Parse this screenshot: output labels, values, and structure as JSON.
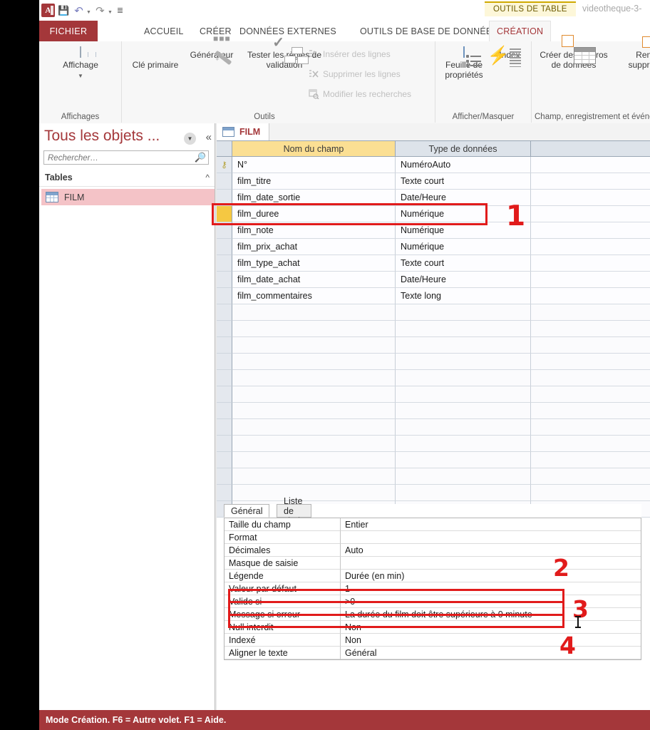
{
  "titlebar": {
    "app_icon": "access-logo-icon",
    "quick_access": [
      {
        "name": "save-icon",
        "glyph": "ὋE"
      },
      {
        "name": "undo-icon",
        "glyph": "↶"
      },
      {
        "name": "redo-icon",
        "glyph": "↷"
      },
      {
        "name": "customize-quick-access-icon",
        "glyph": "≡"
      }
    ],
    "contextual_tools_label": "OUTILS DE TABLE",
    "document_title": "videotheque-3-"
  },
  "ribbon": {
    "tabs": [
      {
        "label": "FICHIER",
        "active": false,
        "file": true
      },
      {
        "label": "ACCUEIL",
        "active": false
      },
      {
        "label": "CRÉER",
        "active": false
      },
      {
        "label": "DONNÉES EXTERNES",
        "active": false
      },
      {
        "label": "OUTILS DE BASE DE DONNÉES",
        "active": false
      },
      {
        "label": "CRÉATION",
        "active": true
      }
    ],
    "groups": [
      {
        "name": "affichages",
        "label": "Affichages",
        "buttons": [
          {
            "label": "Affichage",
            "caret": "▾"
          }
        ]
      },
      {
        "name": "outils",
        "label": "Outils",
        "buttons": [
          {
            "label": "Clé primaire"
          },
          {
            "label": "Générateur"
          },
          {
            "label": "Tester les règles de validation"
          }
        ],
        "small_commands": [
          {
            "label": "Insérer des lignes"
          },
          {
            "label": "Supprimer les lignes"
          },
          {
            "label": "Modifier les recherches"
          }
        ]
      },
      {
        "name": "afficher-masquer",
        "label": "Afficher/Masquer",
        "buttons": [
          {
            "label": "Feuille de propriétés"
          },
          {
            "label": "Index"
          }
        ]
      },
      {
        "name": "champ-enregistrement-evenements",
        "label": "Champ, enregistrement et événeme",
        "buttons": [
          {
            "label": "Créer des macros de données",
            "caret": "▾"
          },
          {
            "label": "Renomm supprimer un"
          }
        ]
      }
    ]
  },
  "navpane": {
    "title": "Tous les objets ...",
    "dropdown_icon": "chevron-down-icon",
    "collapse_icon": "double-chevron-left-icon",
    "search_placeholder": "Rechercher…",
    "search_value": "",
    "search_icon": "search-icon",
    "groups": [
      {
        "label": "Tables",
        "collapse_glyph": "«",
        "items": [
          {
            "label": "FILM",
            "icon": "table-icon",
            "selected": true
          }
        ]
      }
    ]
  },
  "document": {
    "tab_label": "FILM",
    "tab_icon": "table-icon",
    "grid": {
      "headers": [
        "Nom du champ",
        "Type de données",
        ""
      ],
      "rows": [
        {
          "field": "N°",
          "type": "NuméroAuto",
          "primary_key": true,
          "selected": false
        },
        {
          "field": "film_titre",
          "type": "Texte court",
          "primary_key": false,
          "selected": false
        },
        {
          "field": "film_date_sortie",
          "type": "Date/Heure",
          "primary_key": false,
          "selected": false
        },
        {
          "field": "film_duree",
          "type": "Numérique",
          "primary_key": false,
          "selected": true
        },
        {
          "field": "film_note",
          "type": "Numérique",
          "primary_key": false,
          "selected": false
        },
        {
          "field": "film_prix_achat",
          "type": "Numérique",
          "primary_key": false,
          "selected": false
        },
        {
          "field": "film_type_achat",
          "type": "Texte court",
          "primary_key": false,
          "selected": false
        },
        {
          "field": "film_date_achat",
          "type": "Date/Heure",
          "primary_key": false,
          "selected": false
        },
        {
          "field": "film_commentaires",
          "type": "Texte long",
          "primary_key": false,
          "selected": false
        }
      ],
      "empty_row_count": 13
    }
  },
  "properties": {
    "tabs": [
      {
        "label": "Général",
        "active": true
      },
      {
        "label": "Liste de choix",
        "active": false
      }
    ],
    "rows": [
      {
        "label": "Taille du champ",
        "value": "Entier",
        "highlight": false
      },
      {
        "label": "Format",
        "value": "",
        "highlight": false
      },
      {
        "label": "Décimales",
        "value": "Auto",
        "highlight": false
      },
      {
        "label": "Masque de saisie",
        "value": "",
        "highlight": false
      },
      {
        "label": "Légende",
        "value": "Durée (en min)",
        "highlight": false
      },
      {
        "label": "Valeur par défaut",
        "value": "1",
        "highlight": true
      },
      {
        "label": "Valide si",
        "value": ">0",
        "highlight": true
      },
      {
        "label": "Message si erreur",
        "value": "La durée du film doit être supérieure à 0 minute",
        "highlight": true
      },
      {
        "label": "Null interdit",
        "value": "Non",
        "highlight": false
      },
      {
        "label": "Indexé",
        "value": "Non",
        "highlight": false
      },
      {
        "label": "Aligner le texte",
        "value": "Général",
        "highlight": false
      }
    ]
  },
  "annotations": {
    "accent_color": "#e11b1b",
    "markers": [
      {
        "number": "1"
      },
      {
        "number": "2"
      },
      {
        "number": "3"
      },
      {
        "number": "4"
      }
    ]
  },
  "statusbar": {
    "text": "Mode Création. F6 = Autre volet. F1 = Aide."
  }
}
